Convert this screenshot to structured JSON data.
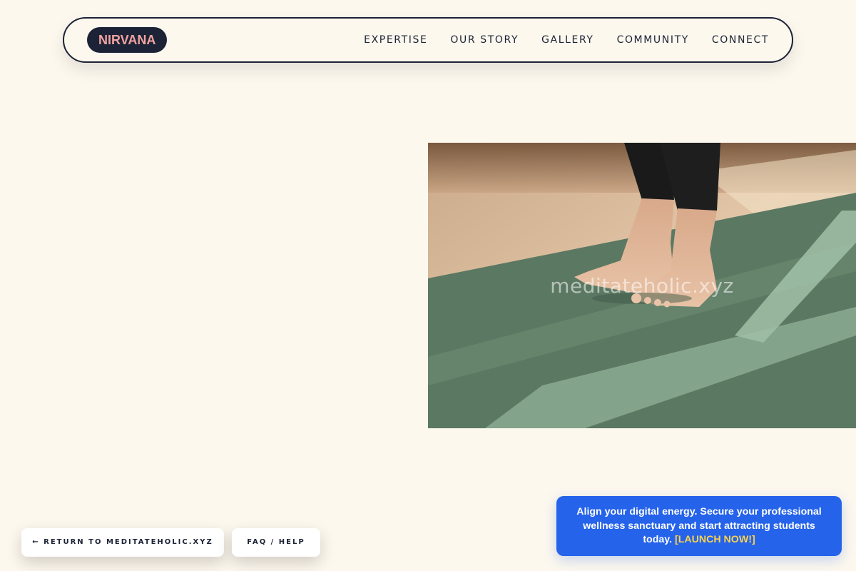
{
  "brand": {
    "logo_text": "NIRVANA",
    "colors": {
      "page_bg": "#fdf8ee",
      "navy": "#1c2336",
      "logo_text": "#f2a3a0",
      "promo_bg": "#2563eb",
      "promo_cta": "#fcd34d"
    }
  },
  "nav": {
    "items": [
      {
        "label": "EXPERTISE"
      },
      {
        "label": "OUR STORY"
      },
      {
        "label": "GALLERY"
      },
      {
        "label": "COMMUNITY"
      },
      {
        "label": "CONNECT"
      }
    ]
  },
  "hero": {
    "image_subject": "bare feet standing on a green yoga mat in sunlight",
    "watermark": "meditateholic.xyz"
  },
  "footer_buttons": {
    "return_label": "← RETURN TO MEDITATEHOLIC.XYZ",
    "faq_label": "FAQ / HELP"
  },
  "promo": {
    "text": "Align your digital energy. Secure your professional wellness sanctuary and start attracting students today.",
    "cta": "[LAUNCH NOW!]"
  }
}
